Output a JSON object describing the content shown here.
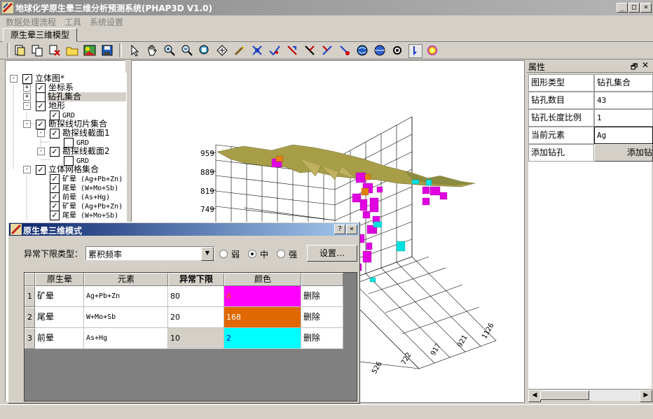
{
  "window": {
    "title": "地球化学原生晕三维分析预测系统(PHAP3D V1.0)",
    "controls": [
      "_",
      "□",
      "×"
    ]
  },
  "menu": [
    "数据处理流程",
    "工具",
    "系统设置"
  ],
  "tab": "原生晕三维模型",
  "toolbar_icons": [
    "open-icon",
    "copy-icon",
    "delete-icon",
    "folder-icon",
    "image-icon",
    "save-icon",
    "pointer-icon",
    "hand-icon",
    "zoom-in-icon",
    "zoom-out-icon",
    "zoom-fit-icon",
    "rotate-icon",
    "wand-icon",
    "move-icon",
    "pick-icon",
    "tool-a-icon",
    "tool-b-icon",
    "tool-c-icon",
    "tool-d-icon",
    "globe-icon",
    "sphere-icon",
    "settings-icon",
    "cursor-icon",
    "color-wheel-icon"
  ],
  "tree": [
    {
      "label": "立体图*",
      "exp": "-",
      "checked": true
    },
    {
      "label": "坐标系",
      "exp": "+",
      "checked": true
    },
    {
      "label": "钻孔集合",
      "exp": "+",
      "checked": false
    },
    {
      "label": "地形",
      "exp": "-",
      "checked": true
    },
    {
      "label": "GRD",
      "checked": true
    },
    {
      "label": "断探线切片集合",
      "exp": "-",
      "checked": true
    },
    {
      "label": "勘探线截面1",
      "exp": "-",
      "checked": true
    },
    {
      "label": "GRD",
      "checked": false
    },
    {
      "label": "勘探线截面2",
      "exp": "-",
      "checked": true
    },
    {
      "label": "GRD",
      "checked": false
    },
    {
      "label": "立体网格集合",
      "exp": "-",
      "checked": true
    },
    {
      "label": "矿晕 (Ag+Pb+Zn)",
      "checked": true
    },
    {
      "label": "尾晕 (W+Mo+Sb)",
      "checked": true
    },
    {
      "label": "前晕 (As+Hg)",
      "checked": true
    },
    {
      "label": "矿晕 (Ag+Pb+Zn)",
      "checked": true
    },
    {
      "label": "尾晕 (W+Mo+Sb)",
      "checked": true
    }
  ],
  "view": {
    "z_ticks": [
      "959",
      "889",
      "819",
      "749"
    ],
    "x_ticks": [
      "526",
      "722",
      "917",
      "921",
      "1126"
    ],
    "colors": {
      "surface": "#a89e48",
      "magenta": "#e000e0",
      "orange": "#e08010",
      "cyan": "#00e0e0"
    }
  },
  "properties": {
    "title": "属性",
    "rows": [
      {
        "key": "图形类型",
        "value": "钻孔集合"
      },
      {
        "key": "钻孔数目",
        "value": "43"
      },
      {
        "key": "钻孔长度比例",
        "value": "1"
      },
      {
        "key": "当前元素",
        "value": "Ag"
      },
      {
        "key": "添加钻孔",
        "value": "添加钻"
      }
    ]
  },
  "dialog": {
    "title": "原生晕三维模式",
    "help": "?",
    "close": "×",
    "type_label": "异常下限类型：",
    "type_value": "累积频率",
    "radios": [
      {
        "label": "弱",
        "selected": false
      },
      {
        "label": "中",
        "selected": true
      },
      {
        "label": "强",
        "selected": false
      }
    ],
    "settings_button": "设置…",
    "columns": [
      "原生晕",
      "元素",
      "异常下限",
      "颜色",
      ""
    ],
    "rows": [
      {
        "index": "1",
        "halo": "矿晕",
        "elements": "Ag+Pb+Zn",
        "threshold": "80",
        "color_value": "8",
        "color": "#ff00ff",
        "action": "删除"
      },
      {
        "index": "2",
        "halo": "尾晕",
        "elements": "W+Mo+Sb",
        "threshold": "20",
        "color_value": "168",
        "color": "#e06800",
        "action": "删除"
      },
      {
        "index": "3",
        "halo": "前晕",
        "elements": "As+Hg",
        "threshold": "10",
        "color_value": "2",
        "color": "#00ffff",
        "action": "删除"
      }
    ]
  }
}
